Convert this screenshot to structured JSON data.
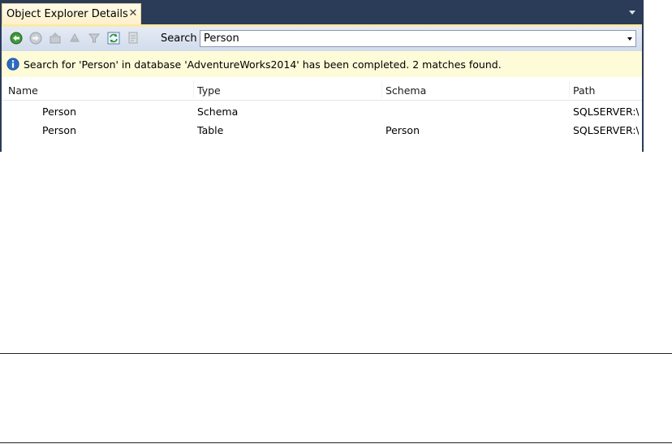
{
  "tab": {
    "title": "Object Explorer Details",
    "close_glyph": "✕"
  },
  "toolbar": {
    "icons": [
      "back-icon",
      "forward-icon",
      "up-icon",
      "sync-icon",
      "filter-icon",
      "refresh-icon",
      "script-icon"
    ],
    "search_label": "Search",
    "search_value": "Person"
  },
  "info": {
    "message": "Search for 'Person' in database 'AdventureWorks2014' has been completed. 2 matches found."
  },
  "columns": [
    "Name",
    "Type",
    "Schema",
    "Path"
  ],
  "rows": [
    {
      "name": "Person",
      "type": "Schema",
      "schema": "",
      "path": "SQLSERVER:\\SQL"
    },
    {
      "name": "Person",
      "type": "Table",
      "schema": "Person",
      "path": "SQLSERVER:\\SQL"
    }
  ],
  "colors": {
    "window_bg": "#2b3c59",
    "tab_bg": "#fdf1c9",
    "info_bg": "#fdfbd8",
    "toolbar_bg": "#dbe3f0"
  }
}
